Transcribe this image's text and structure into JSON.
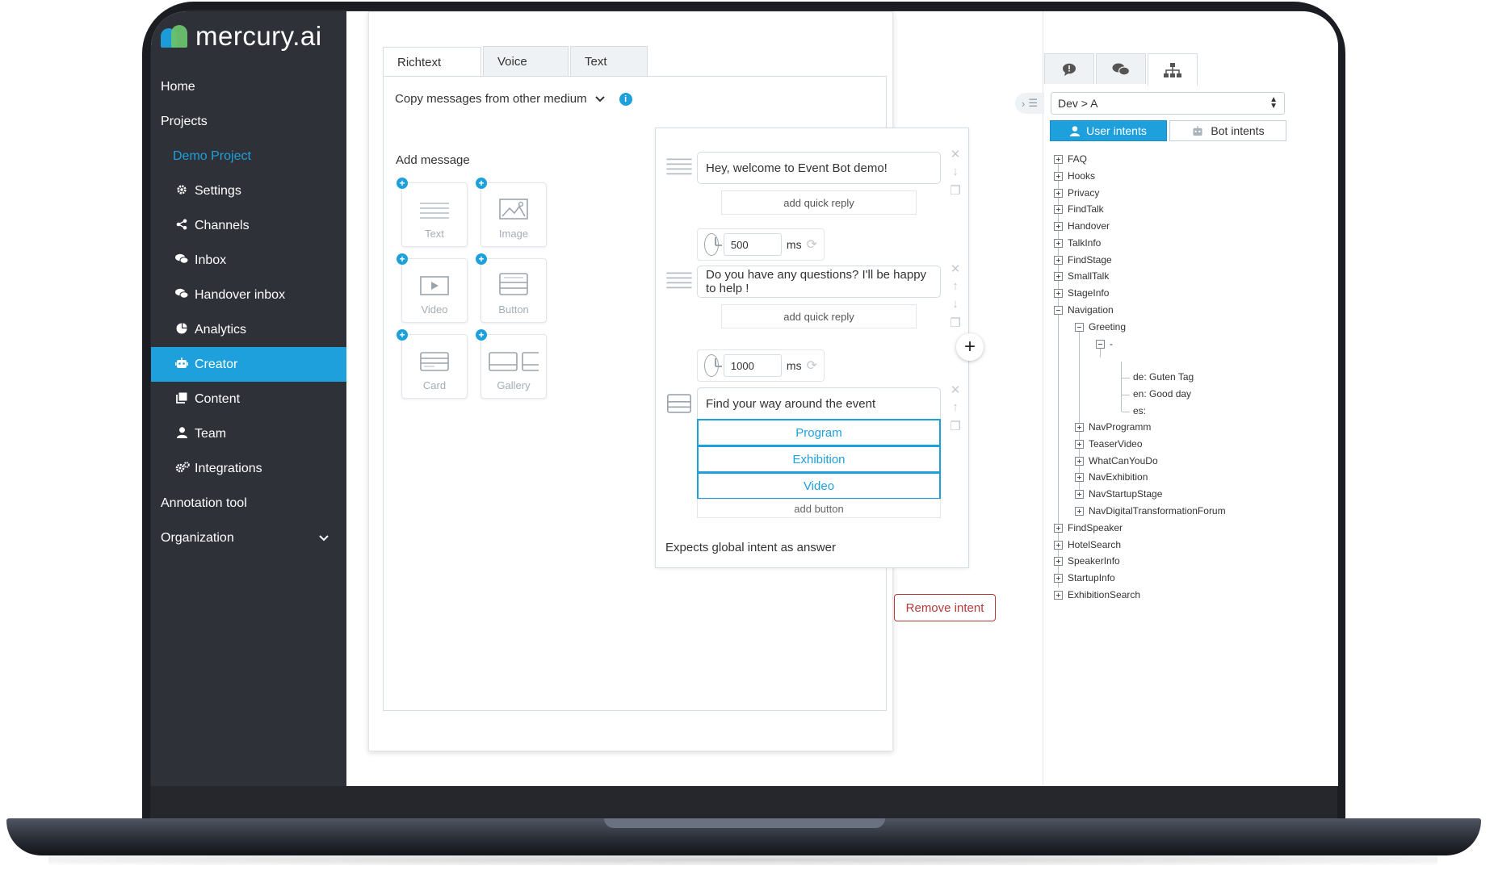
{
  "app": {
    "logo_text": "mercury.ai"
  },
  "sidebar": {
    "items": [
      {
        "label": "Home",
        "icon": ""
      },
      {
        "label": "Projects",
        "icon": ""
      },
      {
        "label": "Demo Project",
        "icon": ""
      },
      {
        "label": "Settings",
        "icon": "gear-icon"
      },
      {
        "label": "Channels",
        "icon": "share-icon"
      },
      {
        "label": "Inbox",
        "icon": "chat-icon"
      },
      {
        "label": "Handover inbox",
        "icon": "chat-icon"
      },
      {
        "label": "Analytics",
        "icon": "pie-chart-icon"
      },
      {
        "label": "Creator",
        "icon": "robot-icon"
      },
      {
        "label": "Content",
        "icon": "copy-icon"
      },
      {
        "label": "Team",
        "icon": "user-icon"
      },
      {
        "label": "Integrations",
        "icon": "gears-icon"
      },
      {
        "label": "Annotation tool",
        "icon": ""
      },
      {
        "label": "Organization",
        "icon": "chevron-down-icon"
      }
    ]
  },
  "editor": {
    "tabs": [
      "Richtext",
      "Voice",
      "Text"
    ],
    "copy_label": "Copy messages from other medium",
    "add_message_label": "Add message",
    "tiles": [
      "Text",
      "Image",
      "Video",
      "Button",
      "Card",
      "Gallery"
    ],
    "messages": {
      "m1": "Hey, welcome to Event Bot demo!",
      "m2": "Do you have any questions? I'll be happy to help !",
      "m3": "Find your way around the event"
    },
    "quick_reply_label": "add quick reply",
    "delay1": "500",
    "delay2": "1000",
    "delay_unit": "ms",
    "buttons": [
      "Program",
      "Exhibition",
      "Video"
    ],
    "add_button_label": "add button",
    "expects_label": "Expects global intent as answer",
    "remove_intent_label": "Remove intent"
  },
  "right": {
    "select_value": "Dev > A",
    "user_intents": "User intents",
    "bot_intents": "Bot intents",
    "tree": {
      "top": [
        "FAQ",
        "Hooks",
        "Privacy",
        "FindTalk",
        "Handover",
        "TalkInfo",
        "FindStage",
        "SmallTalk",
        "StageInfo",
        "Navigation"
      ],
      "greeting": "Greeting",
      "dash": "-",
      "translations": [
        "de: Guten Tag",
        "en: Good day",
        "es:"
      ],
      "nav_children": [
        "NavProgramm",
        "TeaserVideo",
        "WhatCanYouDo",
        "NavExhibition",
        "NavStartupStage",
        "NavDigitalTransformationForum"
      ],
      "bottom": [
        "FindSpeaker",
        "HotelSearch",
        "SpeakerInfo",
        "StartupInfo",
        "ExhibitionSearch"
      ]
    }
  }
}
